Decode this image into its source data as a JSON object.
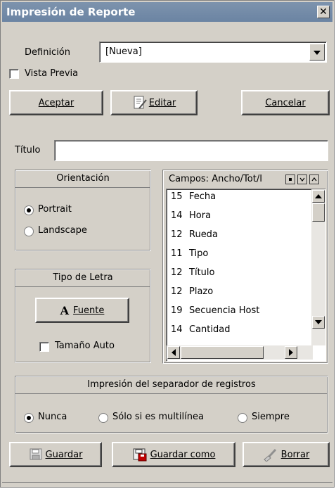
{
  "window": {
    "title": "Impresión de Reporte",
    "close": "✕"
  },
  "definicion": {
    "label": "Definición",
    "value": "[Nueva]"
  },
  "vista_previa": {
    "label": "Vista Previa",
    "checked": false
  },
  "buttons": {
    "aceptar": "Aceptar",
    "editar": "Editar",
    "cancelar": "Cancelar",
    "fuente": "Fuente",
    "guardar": "Guardar",
    "guardar_como": "Guardar como",
    "borrar": "Borrar"
  },
  "titulo": {
    "label": "Título",
    "value": ""
  },
  "orientacion": {
    "title": "Orientación",
    "options": [
      "Portrait",
      "Landscape"
    ],
    "selected": "Portrait"
  },
  "tipo_letra": {
    "title": "Tipo de Letra",
    "font_glyph": "A",
    "tamano_auto": {
      "label": "Tamaño Auto",
      "checked": false
    }
  },
  "campos": {
    "header": "Campos: Ancho/Tot/I",
    "items": [
      {
        "width": "15",
        "name": "Fecha"
      },
      {
        "width": "14",
        "name": "Hora"
      },
      {
        "width": "12",
        "name": "Rueda"
      },
      {
        "width": "11",
        "name": "Tipo"
      },
      {
        "width": "12",
        "name": "Título"
      },
      {
        "width": "12",
        "name": "Plazo"
      },
      {
        "width": "19",
        "name": "Secuencia Host"
      },
      {
        "width": "14",
        "name": "Cantidad"
      }
    ]
  },
  "separador": {
    "title": "Impresión del separador de registros",
    "options": [
      "Nunca",
      "Sólo si es multilínea",
      "Siempre"
    ],
    "selected": "Nunca"
  }
}
